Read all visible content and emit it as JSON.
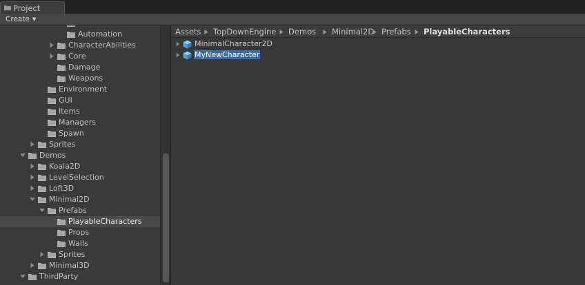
{
  "tab": {
    "label": "Project"
  },
  "toolbar": {
    "create_label": "Create"
  },
  "tree": [
    {
      "label": "Advanced",
      "depth": 4,
      "fold": "none"
    },
    {
      "label": "Automation",
      "depth": 4,
      "fold": "none"
    },
    {
      "label": "CharacterAbilities",
      "depth": 3,
      "fold": "collapsed"
    },
    {
      "label": "Core",
      "depth": 3,
      "fold": "collapsed"
    },
    {
      "label": "Damage",
      "depth": 3,
      "fold": "none"
    },
    {
      "label": "Weapons",
      "depth": 3,
      "fold": "none"
    },
    {
      "label": "Environment",
      "depth": 2,
      "fold": "none"
    },
    {
      "label": "GUI",
      "depth": 2,
      "fold": "none"
    },
    {
      "label": "Items",
      "depth": 2,
      "fold": "none"
    },
    {
      "label": "Managers",
      "depth": 2,
      "fold": "none"
    },
    {
      "label": "Spawn",
      "depth": 2,
      "fold": "none"
    },
    {
      "label": "Sprites",
      "depth": 1,
      "fold": "collapsed"
    },
    {
      "label": "Demos",
      "depth": 0,
      "fold": "expanded"
    },
    {
      "label": "Koala2D",
      "depth": 1,
      "fold": "collapsed"
    },
    {
      "label": "LevelSelection",
      "depth": 1,
      "fold": "collapsed"
    },
    {
      "label": "Loft3D",
      "depth": 1,
      "fold": "collapsed"
    },
    {
      "label": "Minimal2D",
      "depth": 1,
      "fold": "expanded"
    },
    {
      "label": "Prefabs",
      "depth": 2,
      "fold": "expanded"
    },
    {
      "label": "PlayableCharacters",
      "depth": 3,
      "fold": "none",
      "selected": true
    },
    {
      "label": "Props",
      "depth": 3,
      "fold": "none"
    },
    {
      "label": "Walls",
      "depth": 3,
      "fold": "none"
    },
    {
      "label": "Sprites",
      "depth": 2,
      "fold": "collapsed"
    },
    {
      "label": "Minimal3D",
      "depth": 1,
      "fold": "collapsed"
    },
    {
      "label": "ThirdParty",
      "depth": 0,
      "fold": "expanded"
    }
  ],
  "breadcrumb": [
    "Assets",
    "TopDownEngine",
    "Demos",
    "Minimal2D",
    "Prefabs",
    "PlayableCharacters"
  ],
  "assets": [
    {
      "label": "MinimalCharacter2D",
      "selected": false
    },
    {
      "label": "MyNewCharacter",
      "selected": true
    }
  ],
  "colors": {
    "folder": "#b7b7b7",
    "selection": "#3d6da6",
    "prefab_cube": "#4aa3df"
  }
}
